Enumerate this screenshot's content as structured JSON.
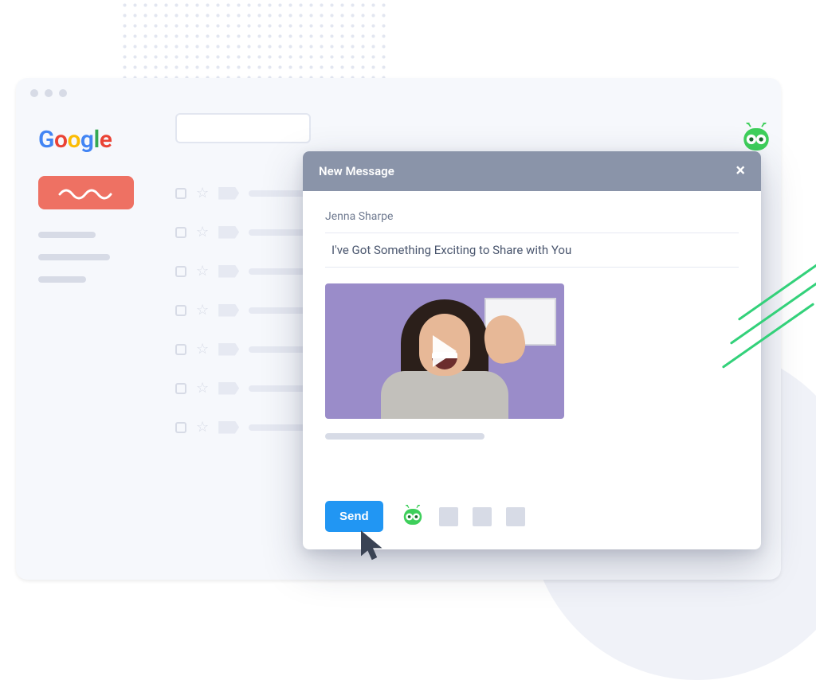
{
  "logo_letters": [
    "G",
    "o",
    "o",
    "g",
    "l",
    "e"
  ],
  "inbox": {
    "rows": 7
  },
  "modal": {
    "title": "New Message",
    "recipient": "Jenna Sharpe",
    "subject": "I've Got Something Exciting to Share with You",
    "send_label": "Send"
  }
}
